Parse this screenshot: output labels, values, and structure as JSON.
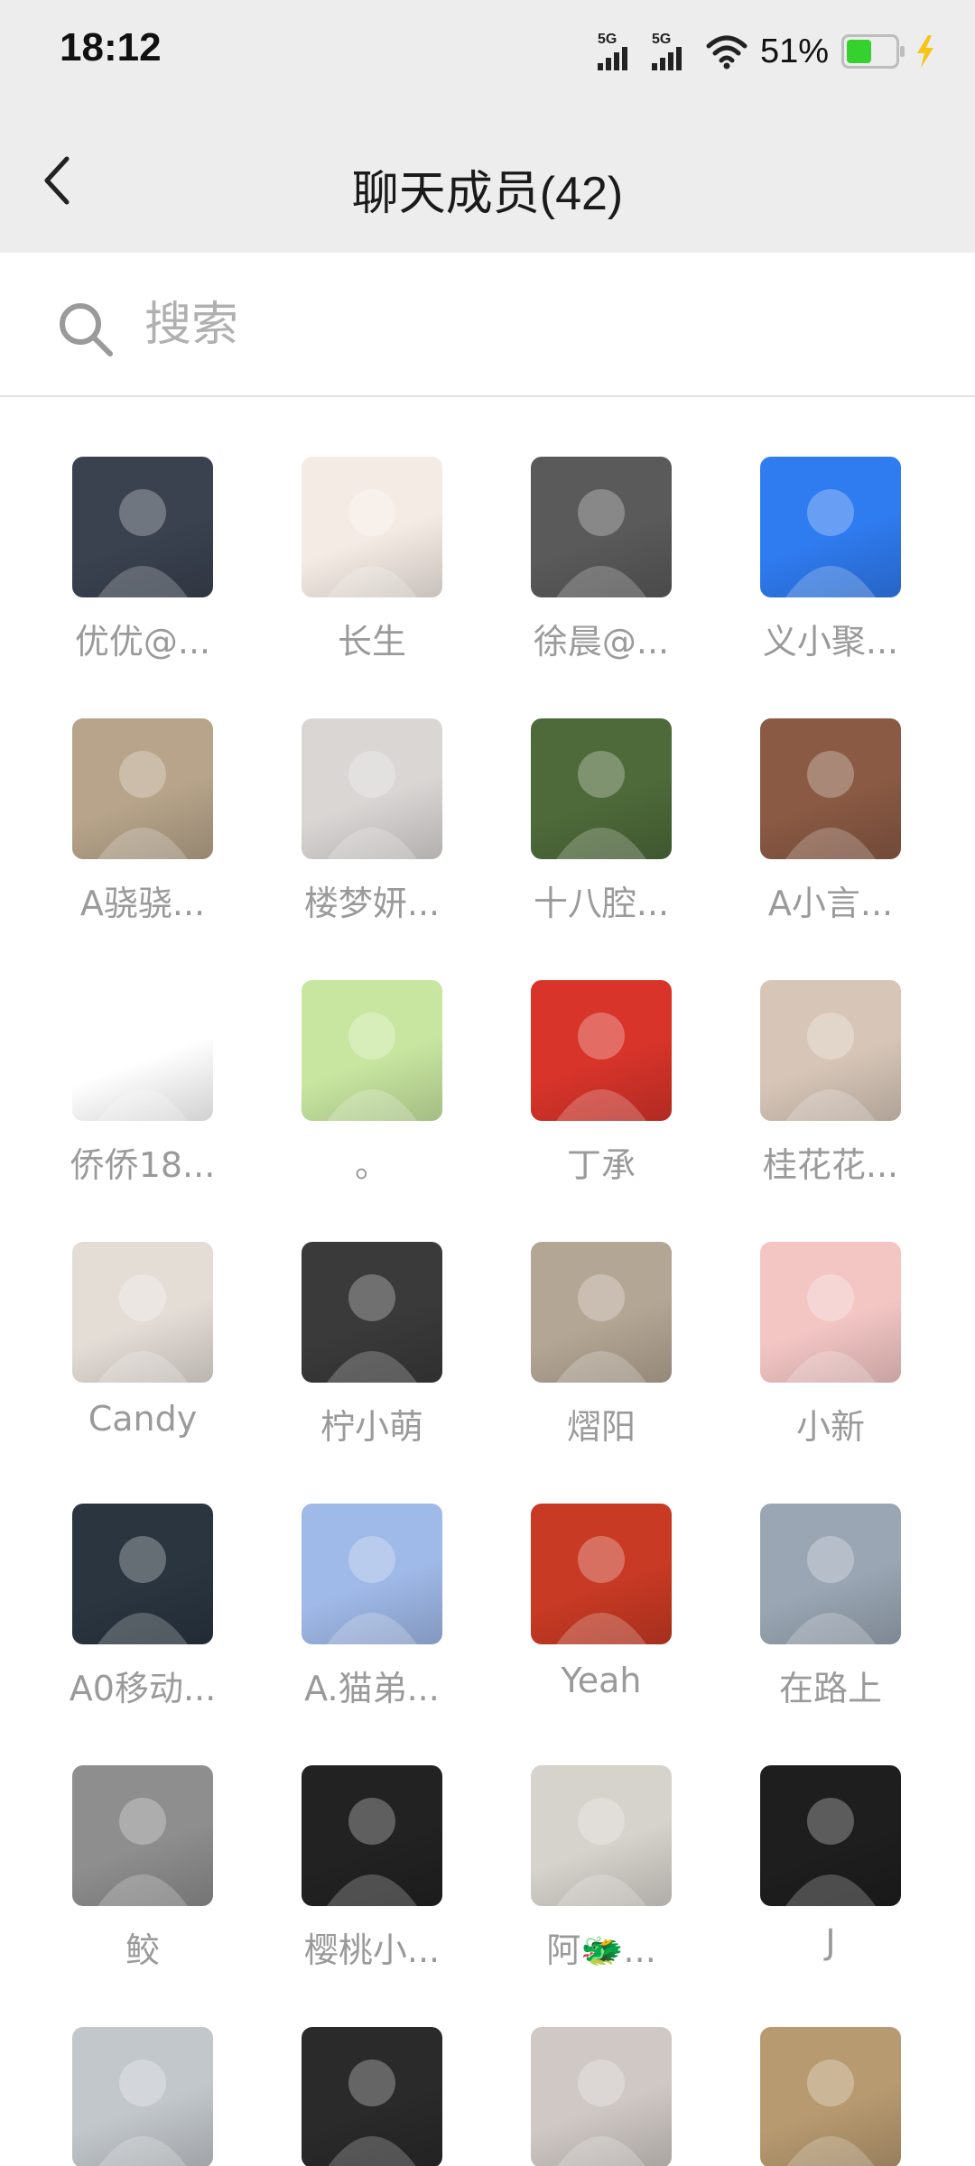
{
  "status_bar": {
    "time": "18:12",
    "signal1_label": "5G",
    "signal2_label": "5G",
    "battery_text": "51%",
    "battery_level": 0.51,
    "battery_color": "#35d12e"
  },
  "header": {
    "title": "聊天成员(42)",
    "back_icon": "chevron-left-icon"
  },
  "search": {
    "placeholder": "搜索",
    "icon": "search-icon"
  },
  "members": [
    {
      "name": "优优@...",
      "avatar_color": "#3a4250"
    },
    {
      "name": "长生",
      "avatar_color": "#f4ebe4"
    },
    {
      "name": "徐晨@...",
      "avatar_color": "#5a5a5a"
    },
    {
      "name": "义小聚...",
      "avatar_color": "#2f7bf0"
    },
    {
      "name": "A骁骁...",
      "avatar_color": "#b7a48a"
    },
    {
      "name": "楼梦妍...",
      "avatar_color": "#d9d6d4"
    },
    {
      "name": "十八腔...",
      "avatar_color": "#4e6a3a"
    },
    {
      "name": "A小言...",
      "avatar_color": "#8a5a44"
    },
    {
      "name": "侨侨18...",
      "avatar_color": "#ffffff"
    },
    {
      "name": "。",
      "avatar_color": "#c8e6a0"
    },
    {
      "name": "丁承",
      "avatar_color": "#d8342a"
    },
    {
      "name": "桂花花...",
      "avatar_color": "#d7c6b8"
    },
    {
      "name": "Candy",
      "avatar_color": "#e4ddd6"
    },
    {
      "name": "柠小萌",
      "avatar_color": "#3a3a3a"
    },
    {
      "name": "熠阳",
      "avatar_color": "#b4a694"
    },
    {
      "name": "小新",
      "avatar_color": "#f3c6c4"
    },
    {
      "name": "A0移动...",
      "avatar_color": "#2a3540"
    },
    {
      "name": "A.猫弟...",
      "avatar_color": "#9fb9e8"
    },
    {
      "name": "Yeah",
      "avatar_color": "#c93a24"
    },
    {
      "name": "在路上",
      "avatar_color": "#9aa6b4"
    },
    {
      "name": "鲛",
      "avatar_color": "#8e8e8e"
    },
    {
      "name": "樱桃小...",
      "avatar_color": "#222222"
    },
    {
      "name": "阿🐲...",
      "avatar_color": "#d6d2cc"
    },
    {
      "name": "J",
      "avatar_color": "#1e1e1e"
    },
    {
      "name": "",
      "avatar_color": "#c2c7cc"
    },
    {
      "name": "",
      "avatar_color": "#2a2a2a"
    },
    {
      "name": "",
      "avatar_color": "#cfc8c4"
    },
    {
      "name": "",
      "avatar_color": "#b89a70"
    }
  ]
}
